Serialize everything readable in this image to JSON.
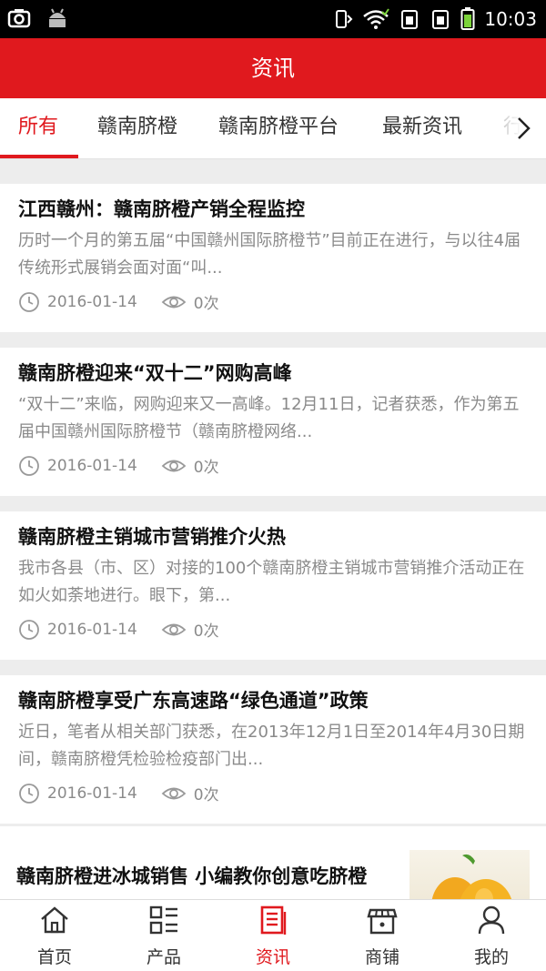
{
  "status_bar": {
    "time": "10:03"
  },
  "header": {
    "title": "资讯"
  },
  "tabs": [
    {
      "label": "所有",
      "active": true
    },
    {
      "label": "赣南脐橙",
      "active": false
    },
    {
      "label": "赣南脐橙平台",
      "active": false
    },
    {
      "label": "最新资讯",
      "active": false
    },
    {
      "label": "行",
      "active": false
    }
  ],
  "articles": [
    {
      "title": "江西赣州：赣南脐橙产销全程监控",
      "summary": "  历时一个月的第五届“中国赣州国际脐橙节”目前正在进行，与以往4届传统形式展销会面对面“叫...",
      "date": "2016-01-14",
      "views": "0次"
    },
    {
      "title": "赣南脐橙迎来“双十二”网购高峰",
      "summary": "“双十二”来临，网购迎来又一高峰。12月11日，记者获悉，作为第五届中国赣州国际脐橙节（赣南脐橙网络...",
      "date": "2016-01-14",
      "views": "0次"
    },
    {
      "title": "赣南脐橙主销城市营销推介火热",
      "summary": "  我市各县（市、区）对接的100个赣南脐橙主销城市营销推介活动正在如火如荼地进行。眼下，第...",
      "date": "2016-01-14",
      "views": "0次"
    },
    {
      "title": "赣南脐橙享受广东高速路“绿色通道”政策",
      "summary": "近日，笔者从相关部门获悉，在2013年12月1日至2014年4月30日期间，赣南脐橙凭检验检疫部门出...",
      "date": "2016-01-14",
      "views": "0次"
    }
  ],
  "partial_article": {
    "title": "赣南脐橙进冰城销售 小编教你创意吃脐橙"
  },
  "bottom_nav": [
    {
      "label": "首页",
      "icon": "home-icon",
      "active": false
    },
    {
      "label": "产品",
      "icon": "product-grid-icon",
      "active": false
    },
    {
      "label": "资讯",
      "icon": "news-document-icon",
      "active": true
    },
    {
      "label": "商铺",
      "icon": "store-icon",
      "active": false
    },
    {
      "label": "我的",
      "icon": "user-icon",
      "active": false
    }
  ],
  "colors": {
    "accent": "#e0191e",
    "muted_text": "#8a8a8a",
    "background": "#ededed"
  }
}
